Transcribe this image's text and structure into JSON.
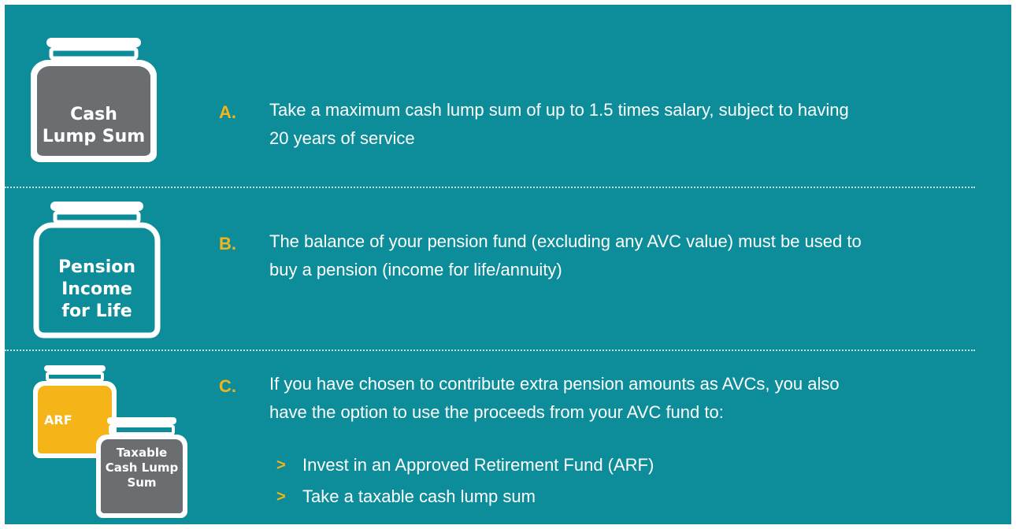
{
  "jars": {
    "cash_lump_sum": {
      "line1": "Cash",
      "line2": "Lump Sum"
    },
    "pension_income": {
      "line1": "Pension",
      "line2": "Income",
      "line3": "for Life"
    },
    "arf": {
      "line1": "ARF"
    },
    "taxable_cash": {
      "line1": "Taxable",
      "line2": "Cash Lump",
      "line3": "Sum"
    }
  },
  "options": [
    {
      "letter": "A.",
      "line1": "Take a maximum cash lump sum of up to 1.5 times salary, subject to having",
      "line2": "20 years of service"
    },
    {
      "letter": "B.",
      "line1": "The balance of your pension fund (excluding any AVC value) must be used to",
      "line2": "buy a pension (income for life/annuity)"
    },
    {
      "letter": "C.",
      "line1": "If you have chosen to contribute extra pension amounts as AVCs, you also",
      "line2": "have the option to use the proceeds from your AVC fund to:"
    }
  ],
  "sub_options": [
    {
      "marker": ">",
      "text": "Invest in an Approved Retirement Fund (ARF)"
    },
    {
      "marker": ">",
      "text": "Take a taxable cash lump sum"
    }
  ],
  "colors": {
    "background": "#0d8d9a",
    "accent": "#f5b417",
    "jar_dark": "#6b6e71",
    "jar_outline": "#ffffff"
  }
}
